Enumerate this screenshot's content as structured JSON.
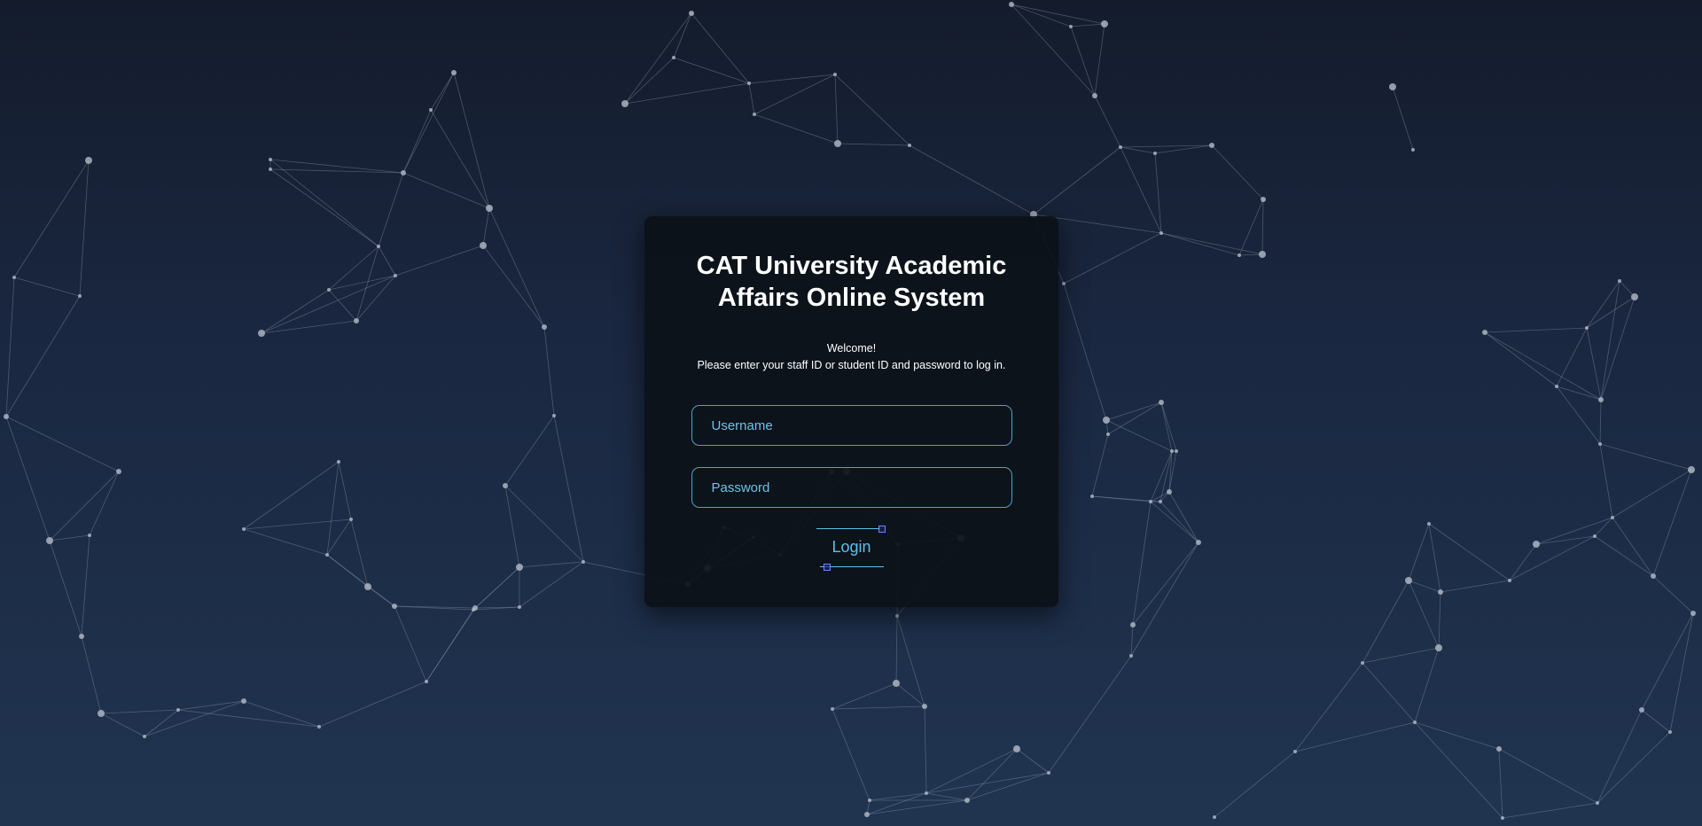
{
  "login": {
    "title": "CAT University Academic Affairs Online System",
    "welcome": "Welcome!",
    "instruction": "Please enter your staff ID or student ID and password to log in.",
    "username_placeholder": "Username",
    "password_placeholder": "Password",
    "button_label": "Login"
  },
  "theme": {
    "background_top": "#141c2c",
    "background_bottom": "#203450",
    "card_background": "#0c1118",
    "accent": "#4aa3c8",
    "button_marker": "#6f87ff"
  }
}
